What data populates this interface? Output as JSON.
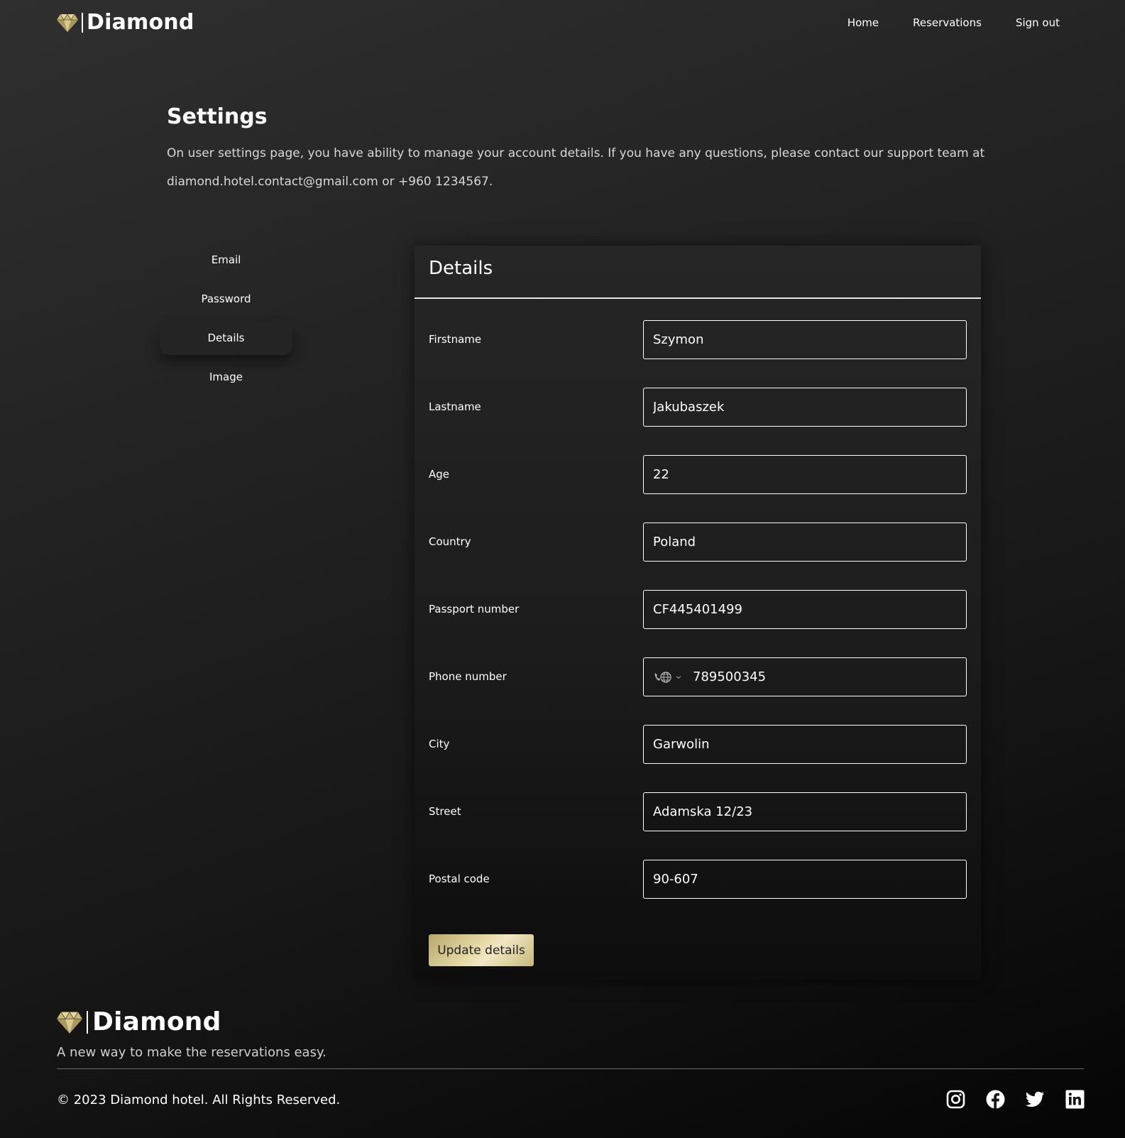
{
  "brand": {
    "name": "Diamond",
    "accent_color": "#d9c88a",
    "logo_icon": "diamond-icon"
  },
  "nav": {
    "home": "Home",
    "reservations": "Reservations",
    "sign_out": "Sign out"
  },
  "intro": {
    "title": "Settings",
    "text": "On user settings page, you have ability to manage your account details. If you have any questions, please contact our support team at diamond.hotel.contact@gmail.com or +960 1234567."
  },
  "side_menu": {
    "items": [
      {
        "label": "Email",
        "active": false
      },
      {
        "label": "Password",
        "active": false
      },
      {
        "label": "Details",
        "active": true
      },
      {
        "label": "Image",
        "active": false
      }
    ]
  },
  "details": {
    "title": "Details",
    "fields": {
      "firstname": {
        "label": "Firstname",
        "value": "Szymon"
      },
      "lastname": {
        "label": "Lastname",
        "value": "Jakubaszek"
      },
      "age": {
        "label": "Age",
        "value": "22"
      },
      "country": {
        "label": "Country",
        "value": "Poland"
      },
      "passport": {
        "label": "Passport number",
        "value": "CF445401499"
      },
      "phone": {
        "label": "Phone number",
        "value": "789500345",
        "prefix_icon": "globe-phone-icon"
      },
      "city": {
        "label": "City",
        "value": "Garwolin"
      },
      "street": {
        "label": "Street",
        "value": "Adamska 12/23"
      },
      "postal": {
        "label": "Postal code",
        "value": "90-607"
      }
    },
    "submit_label": "Update details"
  },
  "footer": {
    "brand": "Diamond",
    "tagline": "A new way to make the reservations easy.",
    "copyright": "© 2023 Diamond hotel. All Rights Reserved.",
    "social_icons": [
      "instagram-icon",
      "facebook-icon",
      "twitter-icon",
      "linkedin-icon"
    ]
  }
}
